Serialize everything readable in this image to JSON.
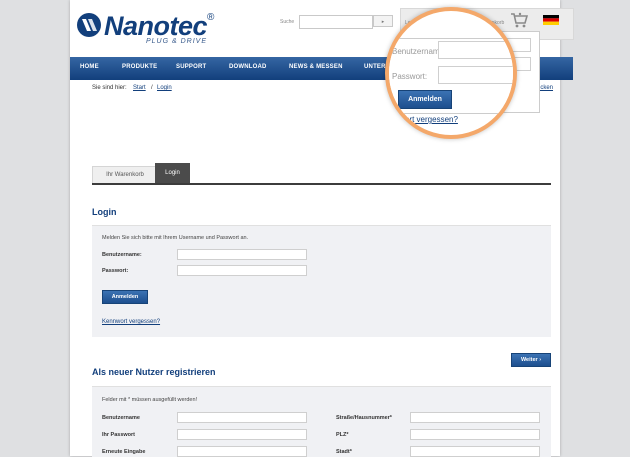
{
  "header": {
    "logo_text": "Nanotec",
    "logo_reg": "®",
    "logo_sub": "PLUG & DRIVE",
    "search_label": "Suche",
    "search_button": "▸",
    "login_label": "Login",
    "cart_label": "Warenkorb"
  },
  "nav": {
    "items": [
      "HOME",
      "PRODUKTE",
      "SUPPORT",
      "DOWNLOAD",
      "NEWS & MESSEN",
      "UNTERN"
    ]
  },
  "breadcrumb": {
    "label": "Sie sind hier:",
    "links": [
      "Start",
      "Login"
    ],
    "separator": "/",
    "back": "ücken"
  },
  "tabs": [
    "Ihr Warenkorb",
    "Login"
  ],
  "login": {
    "heading": "Login",
    "intro": "Melden Sie sich bitte mit Ihrem Username und Passwort an.",
    "username_label": "Benutzername:",
    "password_label": "Passwort:",
    "submit": "Anmelden",
    "forgot": "Kennwort vergessen?"
  },
  "register": {
    "heading": "Als neuer Nutzer registrieren",
    "next_button": "Weiter ›",
    "required_note": "Felder mit * müssen ausgefüllt werden!",
    "left_fields": [
      "Benutzername",
      "Ihr Passwort",
      "Erneute Eingabe"
    ],
    "right_fields": [
      "Straße/Hausnummer*",
      "PLZ*",
      "Stadt*"
    ]
  },
  "zoom": {
    "username_placeholder": "Benutzername",
    "password_placeholder": "Passwort:",
    "submit": "Anmelden",
    "forgot": "ort vergessen?"
  },
  "colors": {
    "brand_blue": "#123f7c",
    "lens_orange": "#f4a86a",
    "panel_bg": "#f0f1f4"
  }
}
